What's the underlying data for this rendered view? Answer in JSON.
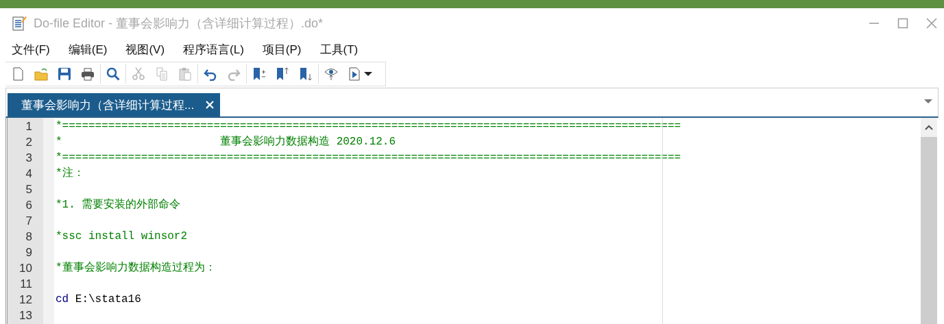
{
  "window": {
    "title": "Do-file Editor - 董事会影响力（含详细计算过程）.do*"
  },
  "menu": [
    "文件(F)",
    "编辑(E)",
    "视图(V)",
    "程序语言(L)",
    "项目(P)",
    "工具(T)"
  ],
  "toolbar": [
    [
      {
        "disabled": false
      },
      {
        "disabled": false
      },
      {
        "disabled": false
      },
      {
        "disabled": false
      }
    ],
    [
      {
        "disabled": false
      }
    ],
    [
      {
        "disabled": true
      },
      {
        "disabled": true
      },
      {
        "disabled": true
      }
    ],
    [
      {
        "disabled": false
      },
      {
        "disabled": true
      }
    ],
    [
      {
        "disabled": false
      },
      {
        "disabled": false
      },
      {
        "disabled": false
      }
    ],
    [
      {
        "disabled": false
      },
      {
        "disabled": false
      }
    ]
  ],
  "tabs": [
    {
      "label": "董事会影响力（含详细计算过程...",
      "selected": true
    }
  ],
  "editor": {
    "lines": [
      {
        "number": "1",
        "segments": [
          {
            "kind": "comment",
            "text": "*=============================================================================================="
          }
        ]
      },
      {
        "number": "2",
        "segments": [
          {
            "kind": "comment",
            "text": "*                        董事会影响力数据构造 2020.12.6"
          }
        ]
      },
      {
        "number": "3",
        "segments": [
          {
            "kind": "comment",
            "text": "*=============================================================================================="
          }
        ]
      },
      {
        "number": "4",
        "segments": [
          {
            "kind": "comment",
            "text": "*注："
          }
        ]
      },
      {
        "number": "5"
      },
      {
        "number": "6",
        "segments": [
          {
            "kind": "comment",
            "text": "*1. 需要安装的外部命令"
          }
        ]
      },
      {
        "number": "7"
      },
      {
        "number": "8",
        "segments": [
          {
            "kind": "comment",
            "text": "*ssc install winsor2"
          }
        ]
      },
      {
        "number": "9"
      },
      {
        "number": "10",
        "segments": [
          {
            "kind": "comment",
            "text": "*董事会影响力数据构造过程为："
          }
        ]
      },
      {
        "number": "11"
      },
      {
        "number": "12",
        "segments": [
          {
            "kind": "keyword",
            "text": "cd"
          },
          {
            "kind": "plain",
            "text": " E:\\stata16"
          }
        ]
      },
      {
        "number": "13"
      }
    ]
  }
}
